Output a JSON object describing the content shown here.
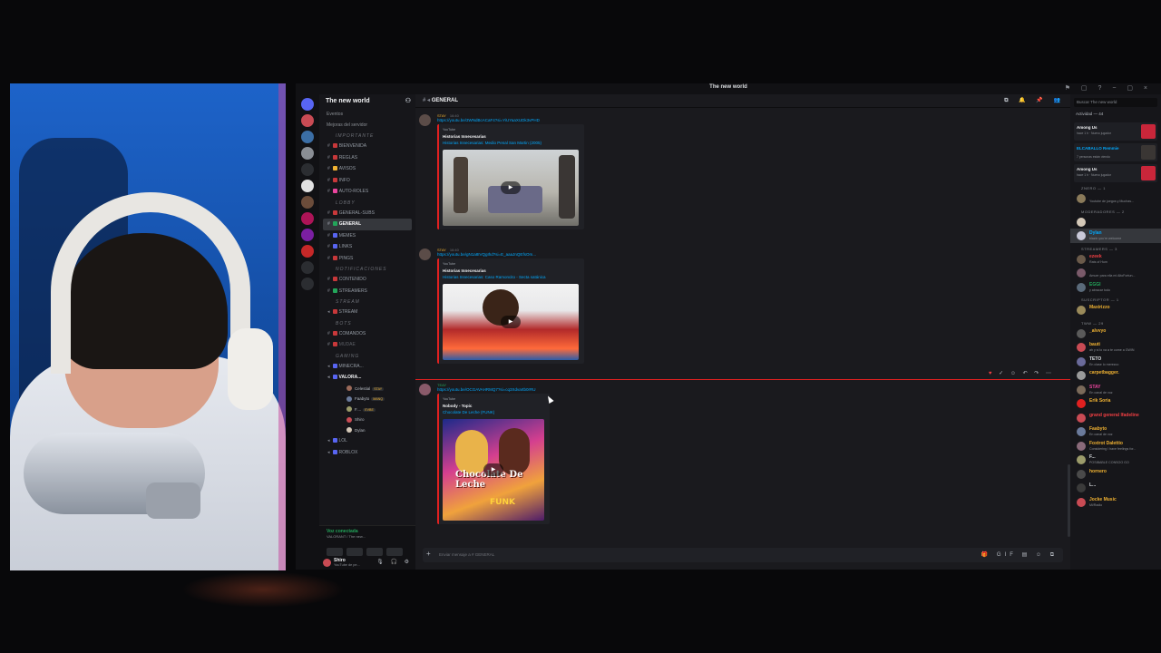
{
  "window": {
    "title": "The new world"
  },
  "server": {
    "name": "The new world",
    "events": "Eventos",
    "boosts": "Mejoras del servidor",
    "categories": {
      "importante": "IMPORTANTE",
      "lobby": "LOBBY",
      "notificaciones": "NOTIFICACIONES",
      "stream": "STREAM",
      "bots": "BOTS",
      "gaming": "GAMING"
    },
    "channels_importante": [
      "BIENVENIDA",
      "REGLAS",
      "AVISOS",
      "INFO",
      "AUTO-ROLES"
    ],
    "channels_lobby": [
      "GENERAL-SUBS",
      "GENERAL",
      "MEMES",
      "LINKS",
      "PINGS"
    ],
    "channels_notif": [
      "CONTENIDO",
      "STREAMERS"
    ],
    "channels_stream": [
      "STREAM"
    ],
    "channels_bots": [
      "COMANDOS",
      "MUDAE"
    ],
    "channels_gaming": [
      "MINECRA...",
      "VALORA..."
    ],
    "voice_users": [
      {
        "name": "Celestial",
        "tag": "STAY"
      },
      {
        "name": "Faabyto",
        "tag": "MANQ"
      },
      {
        "name": "F....",
        "tag": "EVBE"
      },
      {
        "name": "Shiro",
        "tag": ""
      },
      {
        "name": "Dylan",
        "tag": ""
      }
    ],
    "channels_after": [
      "LOL",
      "ROBLOX",
      "GTA"
    ]
  },
  "voice_bar": {
    "status": "Voz conectada",
    "channel": "VALORANT / The new..."
  },
  "user": {
    "name": "Shiro",
    "status": "YouTube de pe..."
  },
  "chat": {
    "channel": "GENERAL",
    "messages": [
      {
        "author": "STAY",
        "time": "16:40",
        "link": "https://youtu.be/3WNdBcACaF4?si=YiUYaaXUDk3vPHD",
        "provider": "YouTube",
        "embed_title": "Historias Innecesarias",
        "embed_link": "Historias Innecesarias: Medio Penal San Martin (2005)"
      },
      {
        "author": "STAY",
        "time": "16:40",
        "link": "https://youtu.be/gN1a8IVQgIhd?si=E_aaaJnQEfsOm...",
        "provider": "YouTube",
        "embed_title": "Historias Innecesarias",
        "embed_link": "Historias Innecesarias: Caso Ramoncito - Secta satánica"
      },
      {
        "author": "TEAY",
        "time": "",
        "link": "https://youtu.be/OCGAVAHRMQ7?si=cq3Xdvartb0rRU",
        "provider": "YouTube",
        "embed_title": "Nobody - Topic",
        "embed_link": "Chocolate De Leche (FUNK)",
        "cover_title": "Chocolate De Leche",
        "cover_sub": "FUNK"
      }
    ],
    "composer_placeholder": "Enviar mensaje a #  GENERAL"
  },
  "members": {
    "search_placeholder": "Buscar The new world",
    "activity_label": "Actividad — 44",
    "activity_cards": [
      {
        "name": "Among Us",
        "status": "hace 1 h · Nuevo jugador"
      },
      {
        "name": "ELCABALLO Remmie",
        "status": "7 personas están viendo"
      },
      {
        "name": "Among Us",
        "status": "hace 1 h · Nuevo jugador"
      }
    ],
    "roles": [
      {
        "label": "ZNERO — 1",
        "members": [
          {
            "name": "",
            "status": "Youtube de juegos y Muchas..."
          }
        ]
      },
      {
        "label": "MODERADORES — 2",
        "members": [
          {
            "name": "",
            "status": ""
          },
          {
            "name": "Dylan",
            "status": "blazin you're welcome"
          }
        ]
      },
      {
        "label": "STREAMERS — 3",
        "members": [
          {
            "name": "ezeek",
            "status": "Rats of Hum"
          },
          {
            "name": "",
            "status": "Amuer para ella mi AltoFortun..."
          },
          {
            "name": "EGGI",
            "status": "y abracar todo"
          }
        ]
      },
      {
        "label": "SUSCRIPTOR — 1",
        "members": [
          {
            "name": "Maxirizzo",
            "status": ""
          }
        ]
      },
      {
        "label": "TWW — 29",
        "members": [
          {
            "name": "_alvvyo",
            "status": ""
          },
          {
            "name": "bauti",
            "status": "ah y si lo va a te come a GWIN"
          },
          {
            "name": "TETO",
            "status": "En clase lo merezco"
          },
          {
            "name": "carpetbagger.",
            "status": ""
          },
          {
            "name": "STAY",
            "status": "En canal de voz"
          },
          {
            "name": "Erik Soria",
            "status": ""
          },
          {
            "name": "grand general lfadeline",
            "status": ""
          },
          {
            "name": "Faabyto",
            "status": "En canal de voz"
          },
          {
            "name": "Foxtrot Dalettio",
            "status": "Considering I have feelings for..."
          },
          {
            "name": "F...",
            "status": "POSIBABLE CONSOO GO"
          },
          {
            "name": "hornero",
            "status": ""
          },
          {
            "name": "L...",
            "status": ""
          },
          {
            "name": "Jocke Music",
            "status": "Mi/Radio"
          }
        ]
      }
    ]
  },
  "colors": {
    "accent_red": "#e02020",
    "link": "#00a8fc",
    "online": "#23a55a"
  }
}
